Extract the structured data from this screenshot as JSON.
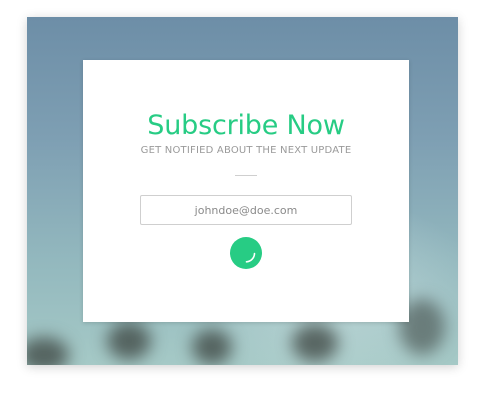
{
  "subscribe": {
    "title": "Subscribe Now",
    "subtitle": "GET NOTIFIED ABOUT THE NEXT UPDATE",
    "email_placeholder": "johndoe@doe.com",
    "email_value": ""
  },
  "colors": {
    "accent": "#27cc84",
    "card_background": "#ffffff",
    "subtitle_text": "#9a9a9a"
  },
  "icons": {
    "submit": "circle-button-arc-icon"
  }
}
